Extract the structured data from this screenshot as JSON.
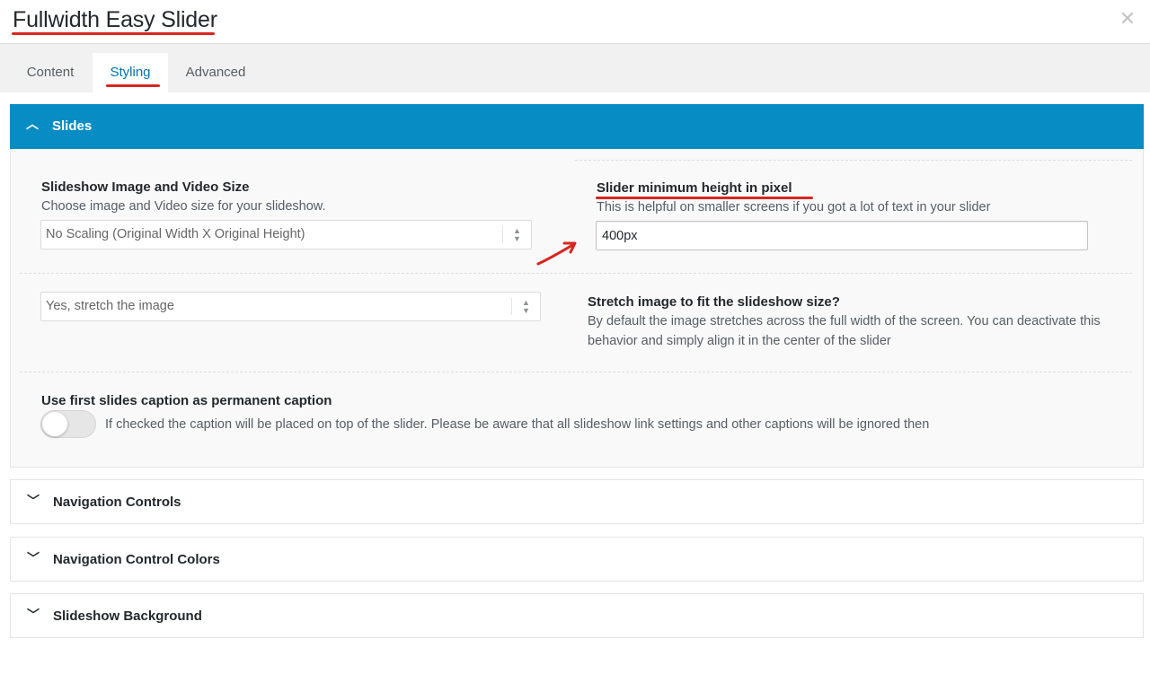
{
  "window": {
    "title": "Fullwidth Easy Slider",
    "close_icon": "close-icon"
  },
  "tabs": [
    {
      "label": "Content",
      "active": false
    },
    {
      "label": "Styling",
      "active": true
    },
    {
      "label": "Advanced",
      "active": false
    }
  ],
  "sections": {
    "slides": {
      "label": "Slides",
      "expanded": true,
      "accent_color": "#088cc4",
      "image_size": {
        "title": "Slideshow Image and Video Size",
        "description": "Choose image and Video size for your slideshow.",
        "selected": "No Scaling (Original Width X Original Height)"
      },
      "min_height": {
        "title": "Slider minimum height in pixel",
        "description": "This is helpful on smaller screens if you got a lot of text in your slider",
        "value": "400px"
      },
      "stretch": {
        "selected": "Yes, stretch the image",
        "title": "Stretch image to fit the slideshow size?",
        "description": "By default the image stretches across the full width of the screen. You can deactivate this behavior and simply align it in the center of the slider"
      },
      "permanent_caption": {
        "title": "Use first slides caption as permanent caption",
        "description": "If checked the caption will be placed on top of the slider. Please be aware that all slideshow link settings and other captions will be ignored then",
        "checked": false
      }
    },
    "navigation_controls": {
      "label": "Navigation Controls",
      "expanded": false
    },
    "navigation_control_colors": {
      "label": "Navigation Control Colors",
      "expanded": false
    },
    "slideshow_background": {
      "label": "Slideshow Background",
      "expanded": false
    }
  },
  "annotations": {
    "color": "#d8261f"
  }
}
